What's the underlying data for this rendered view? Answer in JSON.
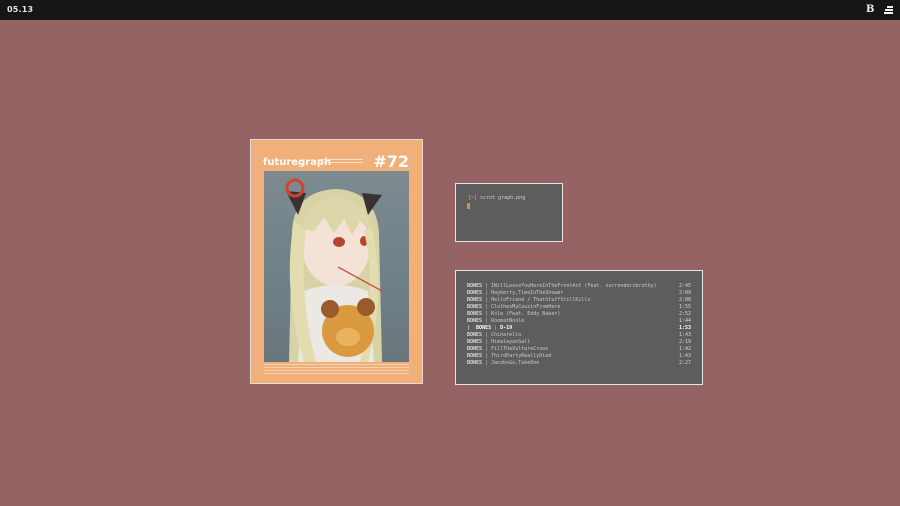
{
  "topbar": {
    "clock": "05.13",
    "b_icon_glyph": "B",
    "menu_icon": "menu-lines-icon"
  },
  "poster": {
    "title": "futuregraph",
    "issue": "#72",
    "colors": {
      "frame": "#f1b07a",
      "border": "#e9d9cf"
    }
  },
  "terminal": {
    "prompt": "[~]",
    "command": "scrot graph.png",
    "cursor_color": "#d09050"
  },
  "playlist": {
    "current_marker": "|",
    "tracks": [
      {
        "artist": "BONES",
        "sep": "|",
        "title": "IWillLeaveYouHereInTheFrontAct (Feat. xurrenderxbrothy)",
        "duration": "2:45"
      },
      {
        "artist": "BONES",
        "sep": "|",
        "title": "Hayberry,TimeInTheShower",
        "duration": "2:09"
      },
      {
        "artist": "BONES",
        "sep": "|",
        "title": "HelloFriend / ThatStuffStillKills",
        "duration": "2:00"
      },
      {
        "artist": "BONES",
        "sep": "|",
        "title": "ClothesMyCousinFromHere",
        "duration": "1:55"
      },
      {
        "artist": "BONES",
        "sep": "|",
        "title": "Kole (Feat. Eddy Baker)",
        "duration": "2:52"
      },
      {
        "artist": "BONES",
        "sep": "|",
        "title": "RoomatNoole",
        "duration": "1:44"
      },
      {
        "artist": "BONES",
        "sep": "|",
        "title": "D-19",
        "duration": "1:53",
        "current": true
      },
      {
        "artist": "BONES",
        "sep": "|",
        "title": "Chinarello",
        "duration": "1:43"
      },
      {
        "artist": "BONES",
        "sep": "|",
        "title": "HimalayanSalt",
        "duration": "2:19"
      },
      {
        "artist": "BONES",
        "sep": "|",
        "title": "FillTheVultureCrows",
        "duration": "1:42"
      },
      {
        "artist": "BONES",
        "sep": "|",
        "title": "ThirdPartyReallyDied",
        "duration": "1:43"
      },
      {
        "artist": "BONES",
        "sep": "|",
        "title": "JacobsGo,TakeOne",
        "duration": "2:27"
      }
    ]
  }
}
